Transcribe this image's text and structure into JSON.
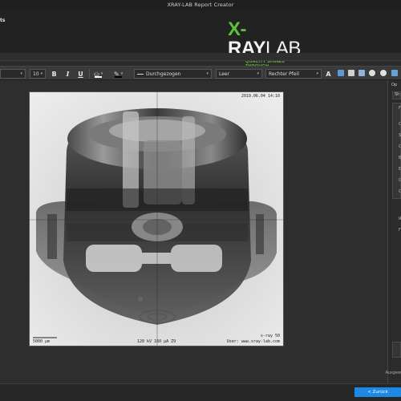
{
  "window": {
    "title": "XRAY-LAB Report Creator",
    "left_fragment": "ts"
  },
  "logo": {
    "x": "X-",
    "ray": "RAY",
    "lab": "LAB",
    "tagline": "QUALITY SHINES THROUGH"
  },
  "toolbar": {
    "font_size": "10",
    "bold_label": "B",
    "italic_label": "I",
    "underline_label": "U",
    "line_style": "Durchgezogen",
    "line_start": "Leer",
    "line_end": "Rechter Pfeil",
    "text_tool_label": "A"
  },
  "image": {
    "timestamp": "2019.06.04 14:10",
    "scale_label": "5000 µm",
    "acquisition": "120 kV  160 µA  Z9",
    "device": "x-ray 50",
    "user": "User: www.xray-lab.com"
  },
  "right_panel": {
    "tab_label": "Op",
    "tab2_label": "Sh",
    "letters": [
      "F",
      "C",
      "S",
      "C",
      "B",
      "E",
      "C",
      "C",
      "R",
      "F"
    ]
  },
  "status": {
    "right_fragment": "Ausgew"
  },
  "footer": {
    "back_label": "< Zurück"
  },
  "colors": {
    "accent": "#1e88e5",
    "brand_green": "#5fbf3a"
  }
}
